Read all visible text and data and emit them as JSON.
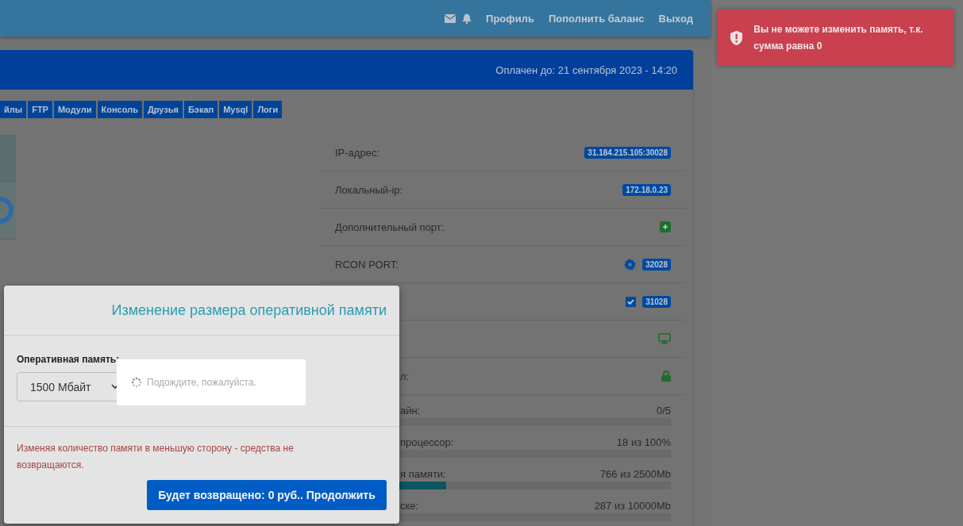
{
  "navbar": {
    "links": [
      {
        "label": "Профиль"
      },
      {
        "label": "Пополнить баланс"
      },
      {
        "label": "Выход"
      }
    ]
  },
  "header": {
    "paid_until": "Оплачен до: 21 сентября 2023 - 14:20"
  },
  "tabs": [
    {
      "label": "йлы"
    },
    {
      "label": "FTP"
    },
    {
      "label": "Модули"
    },
    {
      "label": "Консоль"
    },
    {
      "label": "Друзья"
    },
    {
      "label": "Бэкап"
    },
    {
      "label": "Mysql"
    },
    {
      "label": "Логи"
    }
  ],
  "info_rows": [
    {
      "kind": "badges",
      "label": "IP-адрес:",
      "badges": [
        "31.184.215.105:30028"
      ]
    },
    {
      "kind": "badges",
      "label": "Локальный-ip:",
      "badges": [
        "172.18.0.23"
      ]
    },
    {
      "kind": "add",
      "label": "Дополнительный порт:"
    },
    {
      "kind": "gear",
      "label": "RCON PORT:",
      "badges": [
        "32028"
      ]
    },
    {
      "kind": "check",
      "checked": true,
      "badges": [
        "31028"
      ]
    },
    {
      "kind": "monitor"
    },
    {
      "kind": "lock",
      "label": "л:",
      "cut": true
    }
  ],
  "usage": [
    {
      "label": "айн:",
      "reading": "0/5",
      "level": 0
    },
    {
      "label": "процессор:",
      "reading": "18 из 100%",
      "level": 0.18
    },
    {
      "label": "я памяти:",
      "reading": "766 из 2500Mb",
      "level": 0.33
    },
    {
      "label": "ске:",
      "reading": "287 из 10000Mb",
      "level": 0.03
    }
  ],
  "modal": {
    "title": "Изменение размера оперативной памяти",
    "field_label": "Оперативная память:",
    "select_value": "1500 Мбайт",
    "loading": "Подождите, пожалуйста.",
    "warning": "Изменяя количество памяти в меньшую сторону - средства не возвращаются.",
    "button": "Будет возвращено: 0  руб.. Продолжить"
  },
  "toast": {
    "message": "Вы не можете изменить память, т.к. сумма равна 0"
  }
}
